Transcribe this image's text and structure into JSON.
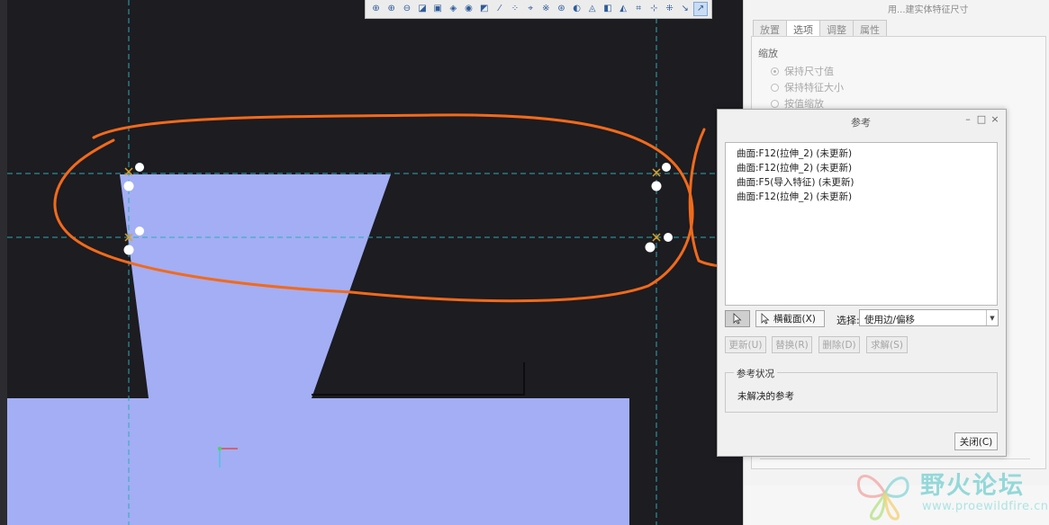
{
  "colors": {
    "canvas": "#1c1c21",
    "part_fill": "#a3aef5",
    "datum": "#2fa9b0",
    "annotation": "#f26a1b",
    "watermark": "#8fd7d8"
  },
  "toolbar": {
    "icons": [
      "zoom-fit-icon",
      "zoom-in-icon",
      "zoom-out-icon",
      "repaint-icon",
      "saved-views-icon",
      "display-style-icon",
      "view-manager-icon",
      "plane-display-icon",
      "axis-display-icon",
      "point-display-icon",
      "csys-display-icon",
      "annotation-display-icon",
      "spin-center-icon",
      "sketch-view-icon",
      "perspective-icon",
      "layers-icon",
      "section-icon",
      "dimension-display-icon",
      "constraint-display-icon",
      "grid-display-icon",
      "vertex-display-icon",
      "references-icon"
    ]
  },
  "dashboard": {
    "title": "用...建实体特征尺寸",
    "tabs": [
      "放置",
      "选项",
      "调整",
      "属性"
    ],
    "selected_tab": "选项",
    "scale_label": "缩放",
    "options": [
      {
        "label": "保持尺寸值",
        "checked": true
      },
      {
        "label": "保持特征大小",
        "checked": false
      },
      {
        "label": "按值缩放",
        "checked": false
      }
    ]
  },
  "dialog": {
    "title": "参考",
    "controls": {
      "minimize": "–",
      "maximize": "□",
      "close": "×"
    },
    "references": [
      "曲面:F12(拉伸_2) (未更新)",
      "曲面:F12(拉伸_2) (未更新)",
      "曲面:F5(导入特征) (未更新)",
      "曲面:F12(拉伸_2) (未更新)"
    ],
    "section_button": "横截面(X)",
    "select_label": "选择:",
    "select_value": "使用边/偏移",
    "actions": [
      "更新(U)",
      "替换(R)",
      "删除(D)",
      "求解(S)"
    ],
    "status_legend": "参考状况",
    "status_text": "未解决的参考",
    "close_button": "关闭(C)"
  },
  "watermark": {
    "title": "野火论坛",
    "url": "www.proewildfire.cn"
  }
}
